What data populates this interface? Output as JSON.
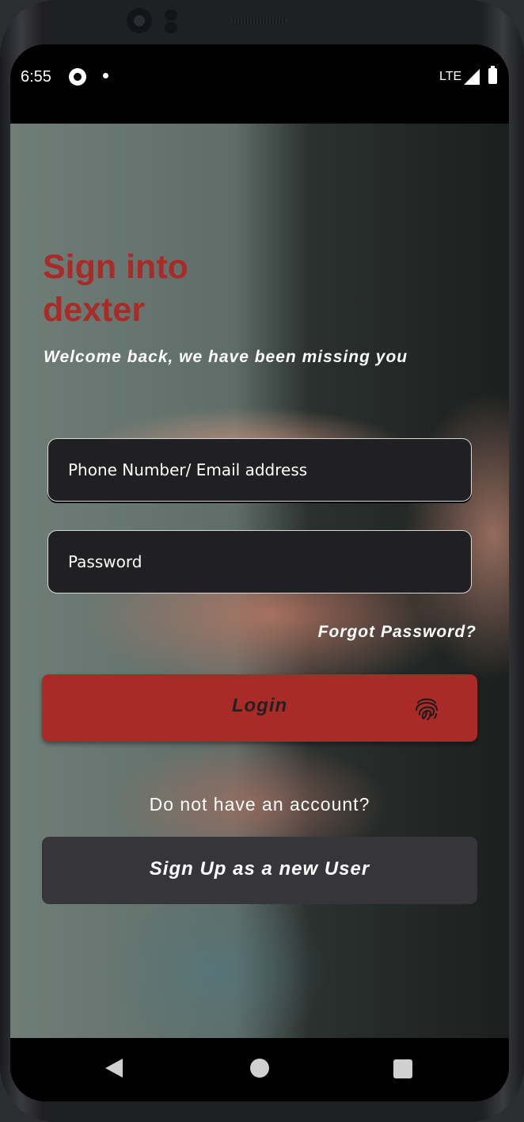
{
  "status_bar": {
    "time": "6:55",
    "network": "LTE",
    "icons": [
      "whatsapp-icon",
      "dot-icon",
      "signal-icon",
      "battery-icon"
    ]
  },
  "login": {
    "title": "Sign into dexter",
    "subtitle": "Welcome back, we have been missing you",
    "phone_placeholder": "Phone Number/ Email address",
    "password_placeholder": "Password",
    "forgot_password": "Forgot Password?",
    "login_label": "Login",
    "no_account_text": "Do not have an account?",
    "signup_label": "Sign Up as a new User"
  },
  "nav_bar": {
    "icons": [
      "back-icon",
      "home-icon",
      "recents-icon"
    ]
  },
  "colors": {
    "accent": "#a92a27",
    "field_bg": "#202022",
    "secondary_button": "#36363a"
  }
}
